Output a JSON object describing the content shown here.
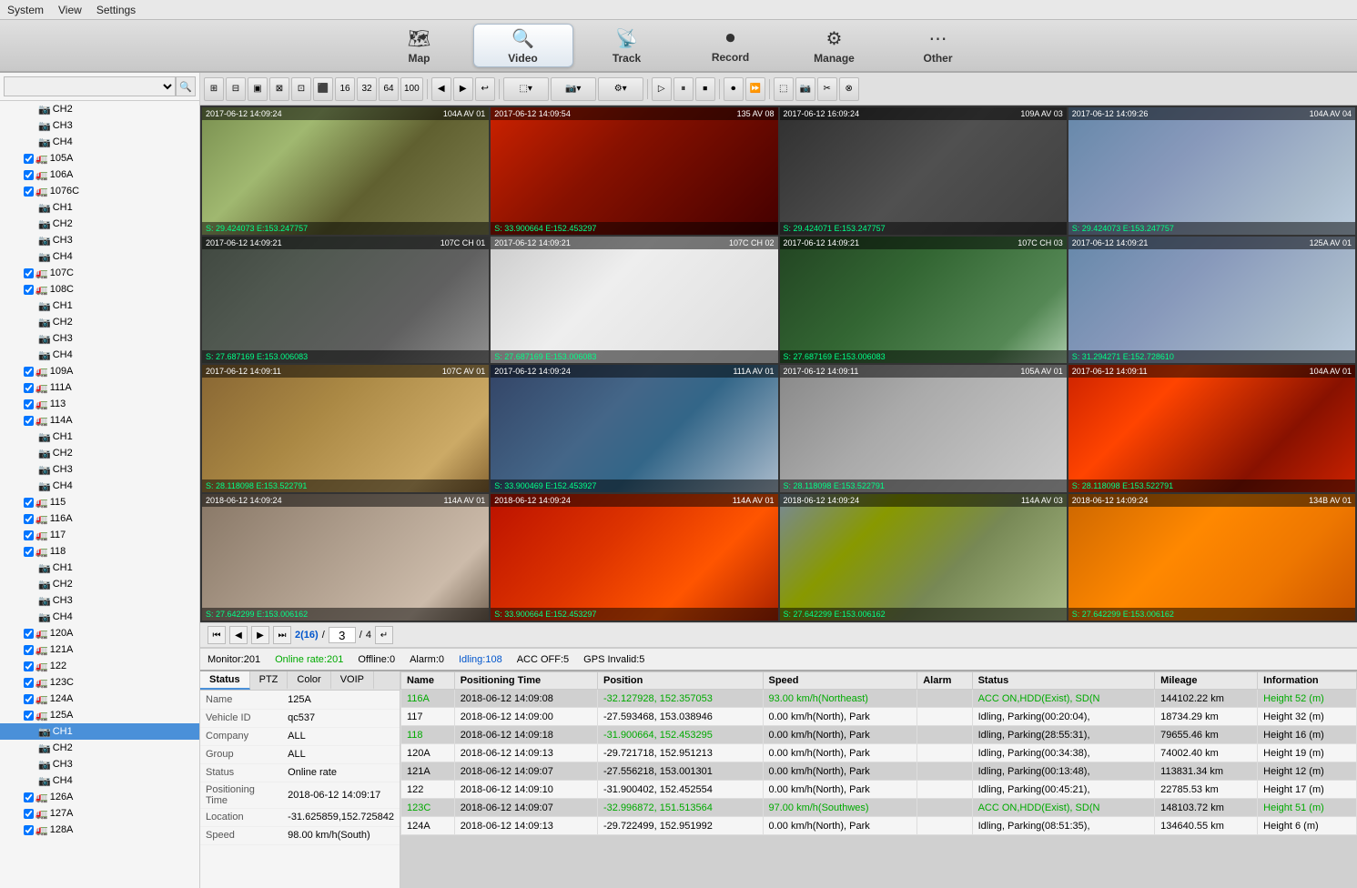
{
  "menuBar": {
    "items": [
      "System",
      "View",
      "Settings"
    ]
  },
  "navTabs": [
    {
      "id": "map",
      "label": "Map",
      "icon": "🗺",
      "active": false
    },
    {
      "id": "video",
      "label": "Video",
      "icon": "🔍",
      "active": true
    },
    {
      "id": "track",
      "label": "Track",
      "icon": "📡",
      "active": false
    },
    {
      "id": "record",
      "label": "Record",
      "icon": "⏺",
      "active": false
    },
    {
      "id": "manage",
      "label": "Manage",
      "icon": "⚙",
      "active": false
    },
    {
      "id": "other",
      "label": "Other",
      "icon": "⋯",
      "active": false
    }
  ],
  "sidebar": {
    "searchPlaceholder": "",
    "treeItems": [
      {
        "id": "ch2",
        "label": "CH2",
        "indent": 3,
        "type": "channel"
      },
      {
        "id": "ch3",
        "label": "CH3",
        "indent": 3,
        "type": "channel"
      },
      {
        "id": "ch4",
        "label": "CH4",
        "indent": 3,
        "type": "channel"
      },
      {
        "id": "105a",
        "label": "105A",
        "indent": 2,
        "type": "vehicle",
        "checked": true
      },
      {
        "id": "106a",
        "label": "106A",
        "indent": 2,
        "type": "vehicle",
        "checked": true
      },
      {
        "id": "1076c",
        "label": "1076C",
        "indent": 2,
        "type": "vehicle",
        "checked": true
      },
      {
        "id": "1076c-ch1",
        "label": "CH1",
        "indent": 3,
        "type": "channel"
      },
      {
        "id": "1076c-ch2",
        "label": "CH2",
        "indent": 3,
        "type": "channel"
      },
      {
        "id": "1076c-ch3",
        "label": "CH3",
        "indent": 3,
        "type": "channel"
      },
      {
        "id": "1076c-ch4",
        "label": "CH4",
        "indent": 3,
        "type": "channel"
      },
      {
        "id": "107c",
        "label": "107C",
        "indent": 2,
        "type": "vehicle",
        "checked": true
      },
      {
        "id": "108c",
        "label": "108C",
        "indent": 2,
        "type": "vehicle",
        "checked": true
      },
      {
        "id": "108c-ch1",
        "label": "CH1",
        "indent": 3,
        "type": "channel"
      },
      {
        "id": "108c-ch2",
        "label": "CH2",
        "indent": 3,
        "type": "channel"
      },
      {
        "id": "108c-ch3",
        "label": "CH3",
        "indent": 3,
        "type": "channel"
      },
      {
        "id": "108c-ch4",
        "label": "CH4",
        "indent": 3,
        "type": "channel"
      },
      {
        "id": "109a",
        "label": "109A",
        "indent": 2,
        "type": "vehicle",
        "checked": true
      },
      {
        "id": "111a",
        "label": "111A",
        "indent": 2,
        "type": "vehicle",
        "checked": true
      },
      {
        "id": "113",
        "label": "113",
        "indent": 2,
        "type": "vehicle",
        "checked": true
      },
      {
        "id": "114a",
        "label": "114A",
        "indent": 2,
        "type": "vehicle",
        "checked": true
      },
      {
        "id": "114a-ch1",
        "label": "CH1",
        "indent": 3,
        "type": "channel"
      },
      {
        "id": "114a-ch2",
        "label": "CH2",
        "indent": 3,
        "type": "channel"
      },
      {
        "id": "114a-ch3",
        "label": "CH3",
        "indent": 3,
        "type": "channel"
      },
      {
        "id": "114a-ch4",
        "label": "CH4",
        "indent": 3,
        "type": "channel"
      },
      {
        "id": "115",
        "label": "115",
        "indent": 2,
        "type": "vehicle",
        "checked": true
      },
      {
        "id": "116a",
        "label": "116A",
        "indent": 2,
        "type": "vehicle",
        "checked": true
      },
      {
        "id": "117",
        "label": "117",
        "indent": 2,
        "type": "vehicle",
        "checked": true
      },
      {
        "id": "118",
        "label": "118",
        "indent": 2,
        "type": "vehicle",
        "checked": true
      },
      {
        "id": "118-ch1",
        "label": "CH1",
        "indent": 3,
        "type": "channel"
      },
      {
        "id": "118-ch2",
        "label": "CH2",
        "indent": 3,
        "type": "channel"
      },
      {
        "id": "118-ch3",
        "label": "CH3",
        "indent": 3,
        "type": "channel"
      },
      {
        "id": "118-ch4",
        "label": "CH4",
        "indent": 3,
        "type": "channel"
      },
      {
        "id": "120a",
        "label": "120A",
        "indent": 2,
        "type": "vehicle",
        "checked": true
      },
      {
        "id": "121a",
        "label": "121A",
        "indent": 2,
        "type": "vehicle",
        "checked": true
      },
      {
        "id": "122",
        "label": "122",
        "indent": 2,
        "type": "vehicle",
        "checked": true
      },
      {
        "id": "123c",
        "label": "123C",
        "indent": 2,
        "type": "vehicle",
        "checked": true
      },
      {
        "id": "124a",
        "label": "124A",
        "indent": 2,
        "type": "vehicle",
        "checked": true
      },
      {
        "id": "125a",
        "label": "125A",
        "indent": 2,
        "type": "vehicle",
        "checked": true
      },
      {
        "id": "125a-ch1",
        "label": "CH1",
        "indent": 3,
        "type": "channel",
        "selected": true
      },
      {
        "id": "125a-ch2",
        "label": "CH2",
        "indent": 3,
        "type": "channel"
      },
      {
        "id": "125a-ch3",
        "label": "CH3",
        "indent": 3,
        "type": "channel"
      },
      {
        "id": "125a-ch4",
        "label": "CH4",
        "indent": 3,
        "type": "channel"
      },
      {
        "id": "126a",
        "label": "126A",
        "indent": 2,
        "type": "vehicle",
        "checked": true
      },
      {
        "id": "127a",
        "label": "127A",
        "indent": 2,
        "type": "vehicle",
        "checked": true
      },
      {
        "id": "128a",
        "label": "128A",
        "indent": 2,
        "type": "vehicle",
        "checked": true
      }
    ]
  },
  "toolbar": {
    "buttons": [
      "⊞",
      "⊟",
      "▣",
      "⊠",
      "⊡",
      "⊞⊞",
      "16",
      "32",
      "64",
      "100",
      "◀",
      "▶",
      "↩",
      "⬛",
      "▷",
      "⏸",
      "⏹",
      "⏺",
      "⏩",
      "⬚",
      "📷",
      "✂",
      "⊗"
    ]
  },
  "videoCells": [
    {
      "id": 1,
      "timestamp": "2017-06-12 14:09:24",
      "label": "104A AV 01",
      "coords": "S: 29.424073 E:153.247757",
      "class": "cam-road-day"
    },
    {
      "id": 2,
      "timestamp": "2017-06-12 14:09:54",
      "label": "135 AV 08",
      "coords": "S: 33.900664 E:152.453297",
      "class": "cam-side-red"
    },
    {
      "id": 3,
      "timestamp": "2017-06-12 16:09:24",
      "label": "109A AV 03",
      "coords": "S: 29.424071 E:153.247757",
      "class": "cam-dark-road"
    },
    {
      "id": 4,
      "timestamp": "2017-06-12 14:09:26",
      "label": "104A AV 04",
      "coords": "S: 29.424073 E:153.247757",
      "class": "cam-highway"
    },
    {
      "id": 5,
      "timestamp": "2017-06-12 14:09:21",
      "label": "107C CH 01",
      "coords": "S: 27.687169 E:153.006083",
      "class": "cam-parking"
    },
    {
      "id": 6,
      "timestamp": "2017-06-12 14:09:21",
      "label": "107C CH 02",
      "coords": "S: 27.687169 E:153.006083",
      "class": "cam-close-white"
    },
    {
      "id": 7,
      "timestamp": "2017-06-12 14:09:21",
      "label": "107C CH 03",
      "coords": "S: 27.687169 E:153.006083",
      "class": "cam-green-truck"
    },
    {
      "id": 8,
      "timestamp": "2017-06-12 14:09:21",
      "label": "125A AV 01",
      "coords": "S: 31.294271 E:152.728610",
      "class": "cam-highway"
    },
    {
      "id": 9,
      "timestamp": "2017-06-12 14:09:11",
      "label": "107C AV 01",
      "coords": "S: 28.118098 E:153.522791",
      "class": "cam-dust"
    },
    {
      "id": 10,
      "timestamp": "2017-06-12 14:09:24",
      "label": "111A AV 01",
      "coords": "S: 33.900469 E:152.453927",
      "class": "cam-blue-car"
    },
    {
      "id": 11,
      "timestamp": "2017-06-12 14:09:11",
      "label": "105A AV 01",
      "coords": "S: 28.118098 E:153.522791",
      "class": "cam-barrier"
    },
    {
      "id": 12,
      "timestamp": "2017-06-12 14:09:11",
      "label": "104A AV 01",
      "coords": "S: 28.118098 E:153.522791",
      "class": "cam-red-truck"
    },
    {
      "id": 13,
      "timestamp": "2018-06-12 14:09:24",
      "label": "114A AV 01",
      "coords": "S: 27.642299 E:153.006162",
      "class": "cam-field"
    },
    {
      "id": 14,
      "timestamp": "2018-06-12 14:09:24",
      "label": "114A AV 01",
      "coords": "S: 33.900664 E:152.453297",
      "class": "cam-red-truck2"
    },
    {
      "id": 15,
      "timestamp": "2018-06-12 14:09:24",
      "label": "114A AV 03",
      "coords": "S: 27.642299 E:153.006162",
      "class": "cam-road2"
    },
    {
      "id": 16,
      "timestamp": "2018-06-12 14:09:24",
      "label": "134B AV 01",
      "coords": "S: 27.642299 E:153.006162",
      "class": "cam-orange-truck"
    }
  ],
  "pagination": {
    "prev": "◀",
    "next": "▶",
    "first": "⏮",
    "last": "⏭",
    "current": "2",
    "total": "16",
    "pageInput": "3",
    "totalPages": "4",
    "goBtnLabel": "↵"
  },
  "statusBar": {
    "monitor": "Monitor:201",
    "online": "Online rate:201",
    "offline": "Offline:0",
    "alarm": "Alarm:0",
    "idling": "Idling:108",
    "accOff": "ACC OFF:5",
    "gpsInvalid": "GPS Invalid:5"
  },
  "infoPanel": {
    "tabs": [
      "Status",
      "PTZ",
      "Color",
      "VOIP"
    ],
    "activeTab": "Status",
    "fields": [
      {
        "label": "Name",
        "value": "125A"
      },
      {
        "label": "Vehicle ID",
        "value": "qc537"
      },
      {
        "label": "Company",
        "value": "ALL"
      },
      {
        "label": "Group",
        "value": "ALL"
      },
      {
        "label": "Status",
        "value": "Online rate"
      },
      {
        "label": "Positioning Time",
        "value": "2018-06-12 14:09:17"
      },
      {
        "label": "Location",
        "value": "-31.625859,152.725842"
      },
      {
        "label": "Speed",
        "value": "98.00 km/h(South)"
      }
    ]
  },
  "dataTable": {
    "columns": [
      "Name",
      "Positioning Time",
      "Position",
      "Speed",
      "Alarm",
      "Status",
      "Mileage",
      "Information"
    ],
    "rows": [
      {
        "name": "116A",
        "nameColor": "green",
        "time": "2018-06-12 14:09:08",
        "position": "-32.127928, 152.357053",
        "posColor": "green",
        "speed": "93.00 km/h(Northeast)",
        "speedColor": "green",
        "alarm": "",
        "status": "ACC ON,HDD(Exist), SD(N",
        "statusColor": "green",
        "mileage": "144102.22 km",
        "info": "Height 52 (m)",
        "infoColor": "green"
      },
      {
        "name": "117",
        "nameColor": "default",
        "time": "2018-06-12 14:09:00",
        "position": "-27.593468, 153.038946",
        "posColor": "default",
        "speed": "0.00 km/h(North), Park",
        "speedColor": "default",
        "alarm": "",
        "status": "Idling, Parking(00:20:04),",
        "statusColor": "default",
        "mileage": "18734.29 km",
        "info": "Height 32 (m)",
        "infoColor": "default"
      },
      {
        "name": "118",
        "nameColor": "green",
        "time": "2018-06-12 14:09:18",
        "position": "-31.900664, 152.453295",
        "posColor": "green",
        "speed": "0.00 km/h(North), Park",
        "speedColor": "default",
        "alarm": "",
        "status": "Idling, Parking(28:55:31),",
        "statusColor": "default",
        "mileage": "79655.46 km",
        "info": "Height 16 (m)",
        "infoColor": "default"
      },
      {
        "name": "120A",
        "nameColor": "default",
        "time": "2018-06-12 14:09:13",
        "position": "-29.721718, 152.951213",
        "posColor": "default",
        "speed": "0.00 km/h(North), Park",
        "speedColor": "default",
        "alarm": "",
        "status": "Idling, Parking(00:34:38),",
        "statusColor": "default",
        "mileage": "74002.40 km",
        "info": "Height 19 (m)",
        "infoColor": "default"
      },
      {
        "name": "121A",
        "nameColor": "default",
        "time": "2018-06-12 14:09:07",
        "position": "-27.556218, 153.001301",
        "posColor": "default",
        "speed": "0.00 km/h(North), Park",
        "speedColor": "default",
        "alarm": "",
        "status": "Idling, Parking(00:13:48),",
        "statusColor": "default",
        "mileage": "113831.34 km",
        "info": "Height 12 (m)",
        "infoColor": "default"
      },
      {
        "name": "122",
        "nameColor": "default",
        "time": "2018-06-12 14:09:10",
        "position": "-31.900402, 152.452554",
        "posColor": "default",
        "speed": "0.00 km/h(North), Park",
        "speedColor": "default",
        "alarm": "",
        "status": "Idling, Parking(00:45:21),",
        "statusColor": "default",
        "mileage": "22785.53 km",
        "info": "Height 17 (m)",
        "infoColor": "default"
      },
      {
        "name": "123C",
        "nameColor": "green",
        "time": "2018-06-12 14:09:07",
        "position": "-32.996872, 151.513564",
        "posColor": "green",
        "speed": "97.00 km/h(Southwes)",
        "speedColor": "green",
        "alarm": "",
        "status": "ACC ON,HDD(Exist), SD(N",
        "statusColor": "green",
        "mileage": "148103.72 km",
        "info": "Height 51 (m)",
        "infoColor": "green"
      },
      {
        "name": "124A",
        "nameColor": "default",
        "time": "2018-06-12 14:09:13",
        "position": "-29.722499, 152.951992",
        "posColor": "default",
        "speed": "0.00 km/h(North), Park",
        "speedColor": "default",
        "alarm": "",
        "status": "Idling, Parking(08:51:35),",
        "statusColor": "default",
        "mileage": "134640.55 km",
        "info": "Height 6 (m)",
        "infoColor": "default"
      }
    ]
  }
}
